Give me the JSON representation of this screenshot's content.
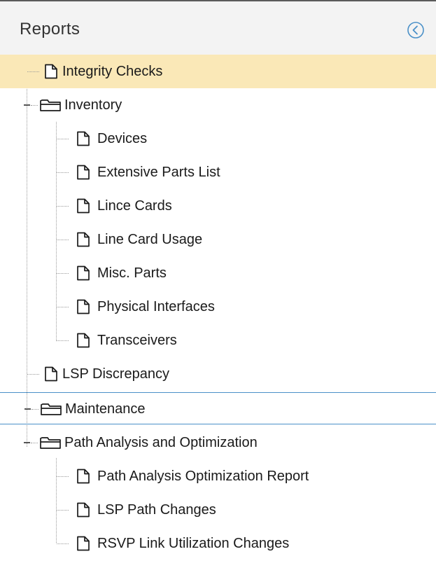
{
  "panel": {
    "title": "Reports",
    "collapse_icon": "chevron-left-circle-icon",
    "colors": {
      "header_bg": "#f3f3f3",
      "selected_bg": "#fae8b7",
      "focus_border": "#4a90c8",
      "accent": "#4a90c8"
    }
  },
  "tree": {
    "items": [
      {
        "label": "Integrity Checks",
        "type": "report",
        "icon": "document-icon",
        "state": "selected"
      },
      {
        "label": "Inventory",
        "type": "folder",
        "icon": "folder-open-icon",
        "expanded": true,
        "children": [
          {
            "label": "Devices",
            "type": "report",
            "icon": "document-icon"
          },
          {
            "label": "Extensive Parts List",
            "type": "report",
            "icon": "document-icon"
          },
          {
            "label": "Lince Cards",
            "type": "report",
            "icon": "document-icon"
          },
          {
            "label": "Line Card Usage",
            "type": "report",
            "icon": "document-icon"
          },
          {
            "label": "Misc. Parts",
            "type": "report",
            "icon": "document-icon"
          },
          {
            "label": "Physical Interfaces",
            "type": "report",
            "icon": "document-icon"
          },
          {
            "label": "Transceivers",
            "type": "report",
            "icon": "document-icon"
          }
        ]
      },
      {
        "label": "LSP Discrepancy",
        "type": "report",
        "icon": "document-icon"
      },
      {
        "label": "Maintenance",
        "type": "folder",
        "icon": "folder-open-icon",
        "expanded": true,
        "state": "focused",
        "children": []
      },
      {
        "label": "Path Analysis and Optimization",
        "type": "folder",
        "icon": "folder-open-icon",
        "expanded": true,
        "children": [
          {
            "label": "Path Analysis Optimization Report",
            "type": "report",
            "icon": "document-icon"
          },
          {
            "label": "LSP Path Changes",
            "type": "report",
            "icon": "document-icon"
          },
          {
            "label": "RSVP Link Utilization Changes",
            "type": "report",
            "icon": "document-icon"
          }
        ]
      }
    ]
  }
}
